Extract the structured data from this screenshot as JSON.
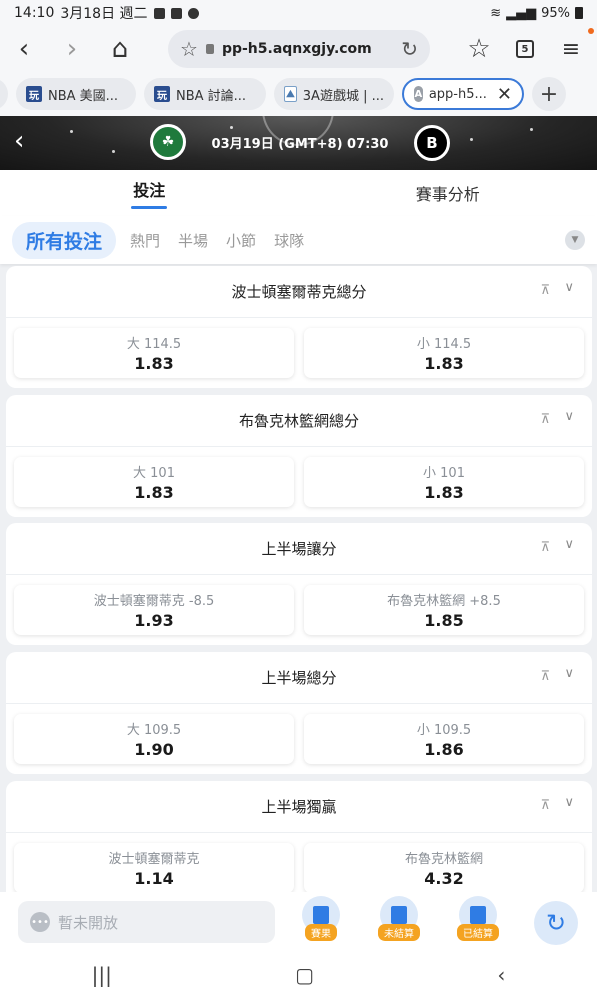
{
  "status": {
    "time": "14:10",
    "date": "3月18日 週二",
    "battery": "95%"
  },
  "browser": {
    "url": "pp-h5.aqnxgjy.com",
    "tab_count": "5",
    "tabs": [
      {
        "label": "NBA 美國...",
        "favicon": "玩"
      },
      {
        "label": "NBA 討論...",
        "favicon": "玩"
      },
      {
        "label": "3A遊戲城 | ...",
        "favicon": "pic"
      },
      {
        "label": "app-h5...",
        "favicon": "A"
      }
    ]
  },
  "match": {
    "datetime": "03月19日 (GMT+8)  07:30"
  },
  "main_tabs": [
    {
      "label": "投注"
    },
    {
      "label": "賽事分析"
    }
  ],
  "sub_tabs": [
    {
      "label": "所有投注"
    },
    {
      "label": "熱門"
    },
    {
      "label": "半場"
    },
    {
      "label": "小節"
    },
    {
      "label": "球隊"
    }
  ],
  "markets": [
    {
      "title": "波士頓塞爾蒂克總分",
      "options": [
        {
          "label": "大 114.5",
          "odd": "1.83"
        },
        {
          "label": "小 114.5",
          "odd": "1.83"
        }
      ]
    },
    {
      "title": "布魯克林籃網總分",
      "options": [
        {
          "label": "大 101",
          "odd": "1.83"
        },
        {
          "label": "小 101",
          "odd": "1.83"
        }
      ]
    },
    {
      "title": "上半場讓分",
      "options": [
        {
          "label": "波士頓塞爾蒂克 -8.5",
          "odd": "1.93"
        },
        {
          "label": "布魯克林籃網 +8.5",
          "odd": "1.85"
        }
      ]
    },
    {
      "title": "上半場總分",
      "options": [
        {
          "label": "大 109.5",
          "odd": "1.90"
        },
        {
          "label": "小 109.5",
          "odd": "1.86"
        }
      ]
    },
    {
      "title": "上半場獨贏",
      "options": [
        {
          "label": "波士頓塞爾蒂克",
          "odd": "1.14"
        },
        {
          "label": "布魯克林籃網",
          "odd": "4.32"
        }
      ]
    }
  ],
  "bottom": {
    "closed_text": "暫未開放",
    "buttons": [
      {
        "label": "賽果"
      },
      {
        "label": "未結算"
      },
      {
        "label": "已結算"
      }
    ]
  },
  "colors": {
    "accent": "#2f7ce4",
    "tag": "#f4a321"
  }
}
